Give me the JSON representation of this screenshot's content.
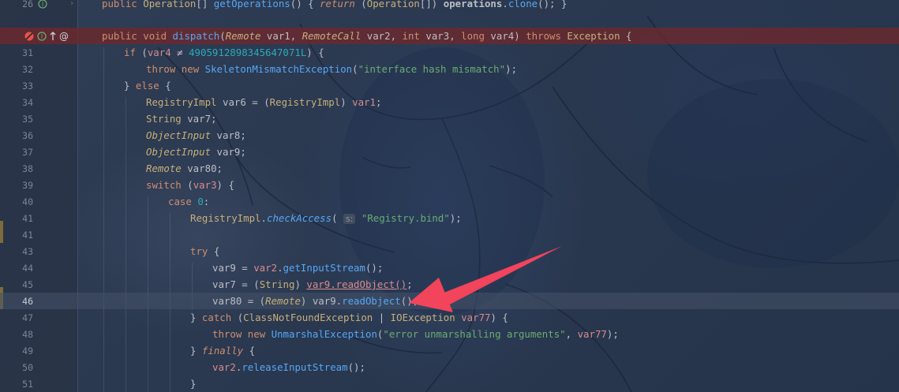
{
  "editor": {
    "lines": [
      {
        "num": "26",
        "text": "public Operation[] getOperations() { return (Operation[]) operations.clone(); }"
      },
      {
        "num": "",
        "text": "public void dispatch(Remote var1, RemoteCall var2, int var3, long var4) throws Exception {"
      },
      {
        "num": "31",
        "text": "if (var4 ≠ 4905912898345647071L) {"
      },
      {
        "num": "32",
        "text": "throw new SkeletonMismatchException(\"interface hash mismatch\");"
      },
      {
        "num": "33",
        "text": "} else {"
      },
      {
        "num": "34",
        "text": "RegistryImpl var6 = (RegistryImpl) var1;"
      },
      {
        "num": "35",
        "text": "String var7;"
      },
      {
        "num": "36",
        "text": "ObjectInput var8;"
      },
      {
        "num": "37",
        "text": "ObjectInput var9;"
      },
      {
        "num": "38",
        "text": "Remote var80;"
      },
      {
        "num": "39",
        "text": "switch (var3) {"
      },
      {
        "num": "40",
        "text": "case 0:"
      },
      {
        "num": "41",
        "text": "RegistryImpl.checkAccess( s: \"Registry.bind\");"
      },
      {
        "num": "41",
        "text": ""
      },
      {
        "num": "43",
        "text": "try {"
      },
      {
        "num": "44",
        "text": "var9 = var2.getInputStream();"
      },
      {
        "num": "45",
        "text": "var7 = (String) var9.readObject();"
      },
      {
        "num": "46",
        "text": "var80 = (Remote) var9.readObject();"
      },
      {
        "num": "47",
        "text": "} catch (ClassNotFoundException | IOException var77) {"
      },
      {
        "num": "48",
        "text": "throw new UnmarshalException(\"error unmarshalling arguments\", var77);"
      },
      {
        "num": "49",
        "text": "} finally {"
      },
      {
        "num": "50",
        "text": "var2.releaseInputStream();"
      },
      {
        "num": "51",
        "text": "}"
      }
    ],
    "breakpoint_line_index": 1,
    "current_line_index": 17,
    "param_hint": "s:"
  },
  "colors": {
    "breakpoint_bg": "#6e282c",
    "keyword": "#cf8e6d",
    "string": "#6aab73",
    "number": "#2aacb8",
    "method": "#56a8f5",
    "arrow": "#f2445b"
  },
  "icons": [
    "breakpoint-icon",
    "implements-icon",
    "override-up-icon",
    "annotation-at-icon",
    "fold-icon"
  ]
}
